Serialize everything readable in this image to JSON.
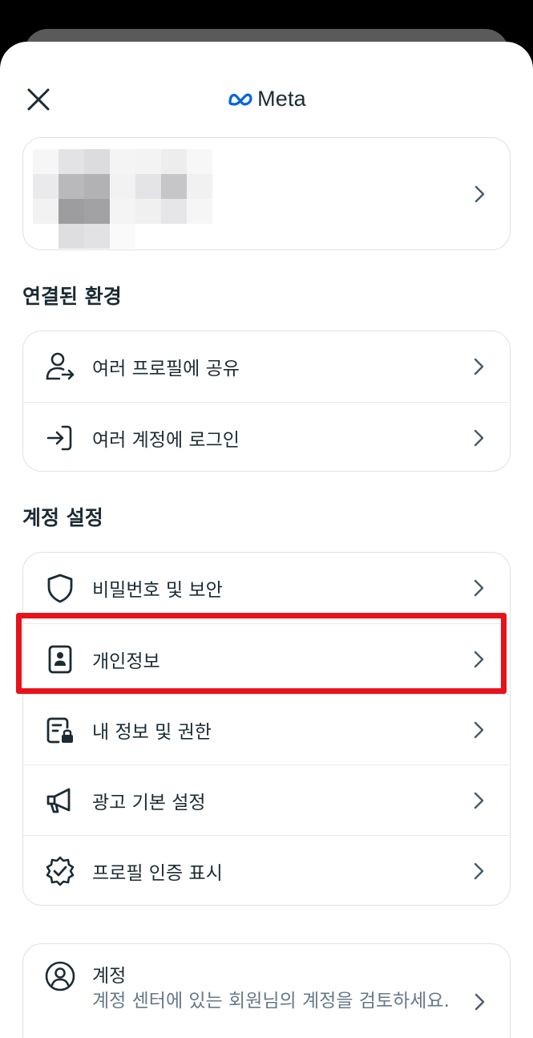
{
  "header": {
    "brand_name": "Meta",
    "close_icon": "close-icon",
    "logo_icon": "meta-infinity-logo-icon",
    "brand_color": "#0064e0"
  },
  "profile_card": {
    "chevron_icon": "chevron-right-icon"
  },
  "connected": {
    "title": "연결된 환경",
    "items": [
      {
        "label": "여러 프로필에 공유",
        "icon": "profile-share-icon"
      },
      {
        "label": "여러 계정에 로그인",
        "icon": "login-arrow-icon"
      }
    ]
  },
  "account_settings": {
    "title": "계정 설정",
    "items": [
      {
        "label": "비밀번호 및 보안",
        "icon": "shield-icon"
      },
      {
        "label": "개인정보",
        "icon": "id-badge-icon"
      },
      {
        "label": "내 정보 및 권한",
        "icon": "document-lock-icon"
      },
      {
        "label": "광고 기본 설정",
        "icon": "megaphone-icon"
      },
      {
        "label": "프로필 인증 표시",
        "icon": "verified-badge-icon"
      }
    ],
    "highlight_color": "#e8121b"
  },
  "account": {
    "title": "계정",
    "description": "계정 센터에 있는 회원님의 계정을 검토하세요.",
    "icon": "account-circle-icon"
  }
}
